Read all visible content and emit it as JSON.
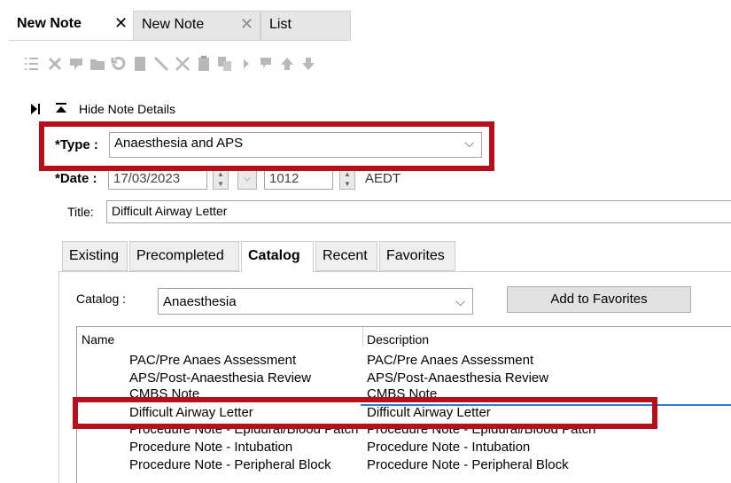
{
  "doc_tabs": [
    {
      "label": "New Note",
      "close": "✕"
    },
    {
      "label": "New Note",
      "close": "✕"
    },
    {
      "label": "List"
    }
  ],
  "details_toggle": {
    "label": "Hide Note Details"
  },
  "type": {
    "label": "*Type :",
    "value": "Anaesthesia and APS"
  },
  "date": {
    "label": "*Date :",
    "value": "17/03/2023",
    "time": "1012",
    "timezone": "AEDT"
  },
  "title_field": {
    "label": "Title:",
    "value": "Difficult Airway Letter"
  },
  "catalog_tabs": [
    "Existing",
    "Precompleted",
    "Catalog",
    "Recent",
    "Favorites"
  ],
  "catalog": {
    "label": "Catalog :",
    "value": "Anaesthesia",
    "add_button": "Add to Favorites"
  },
  "list": {
    "columns": [
      "Name",
      "Description"
    ],
    "rows": [
      {
        "name": "PAC/Pre Anaes  Assessment",
        "description": "PAC/Pre Anaes  Assessment"
      },
      {
        "name": "APS/Post-Anaesthesia Review",
        "description": "APS/Post-Anaesthesia Review"
      },
      {
        "name": "CMBS Note",
        "description": "CMBS Note"
      },
      {
        "name": "Difficult Airway Letter",
        "description": "Difficult Airway Letter"
      },
      {
        "name": "Procedure Note - Epidural/Blood Patch",
        "description": "Procedure Note - Epidural/Blood Patch"
      },
      {
        "name": "Procedure Note - Intubation",
        "description": "Procedure Note - Intubation"
      },
      {
        "name": "Procedure Note - Peripheral Block",
        "description": "Procedure Note - Peripheral Block"
      }
    ]
  },
  "colors": {
    "highlight": "#b60f1a",
    "selection": "#2a7ad8"
  }
}
